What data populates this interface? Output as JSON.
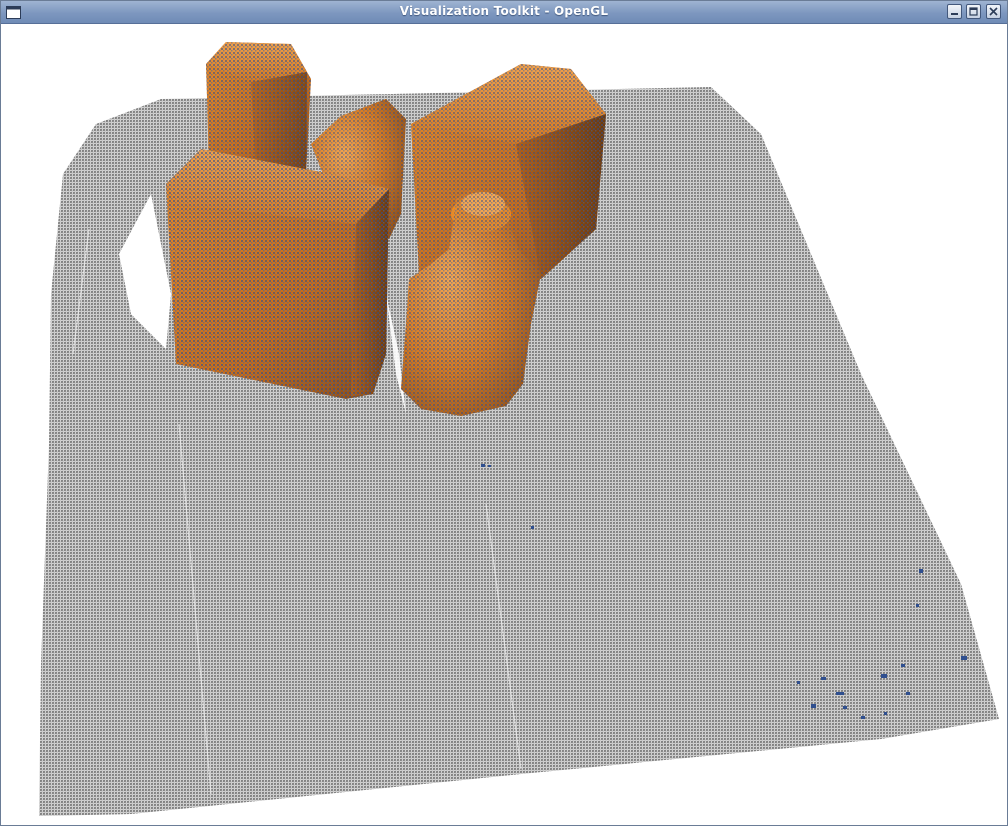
{
  "window": {
    "title": "Visualization Toolkit - OpenGL"
  },
  "titlebar": {
    "menu_icon": "window-menu-icon",
    "buttons": [
      {
        "name": "minimize-icon"
      },
      {
        "name": "maximize-icon"
      },
      {
        "name": "close-icon"
      }
    ]
  },
  "scene": {
    "description_icon": "point-cloud-render",
    "colors": {
      "background": "#ffffff",
      "table_points": "#8c8c8c",
      "object_mesh": "#d87a1e",
      "object_mesh_shadow": "#8a4a12",
      "cloud_points": "#2f4f8f"
    }
  }
}
